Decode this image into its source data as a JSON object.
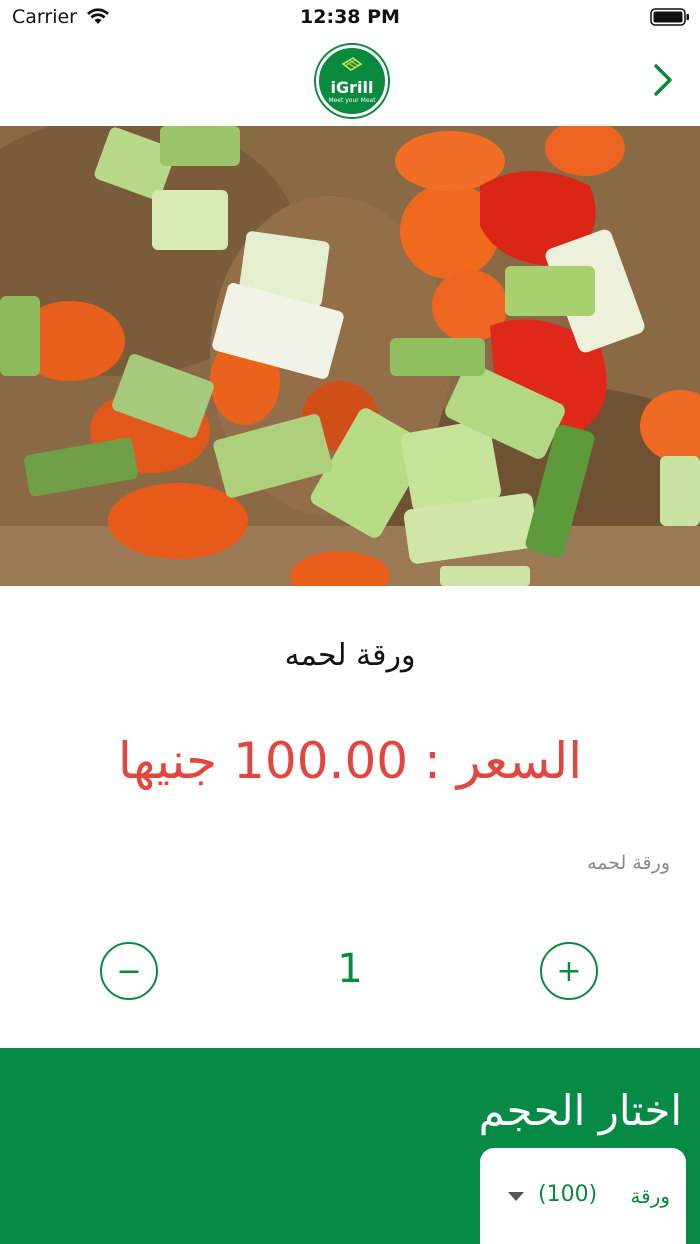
{
  "status_bar": {
    "carrier": "Carrier",
    "time": "12:38 PM"
  },
  "header": {
    "logo_text": "iGrill",
    "logo_tagline": "Meet your Meat",
    "back_icon": "chevron-right-icon"
  },
  "product": {
    "name": "ورقة لحمه",
    "price": "السعر :  100.00 جنيها",
    "description": "ورقة لحمه"
  },
  "quantity": {
    "value": "1",
    "minus_label": "−",
    "plus_label": "+"
  },
  "size": {
    "title": "اختار الحجم",
    "selected_label": "ورقة",
    "selected_count": "(100)"
  },
  "colors": {
    "brand_green": "#0a8a3e",
    "panel_green": "#068a46",
    "price_red": "#e2463d"
  }
}
